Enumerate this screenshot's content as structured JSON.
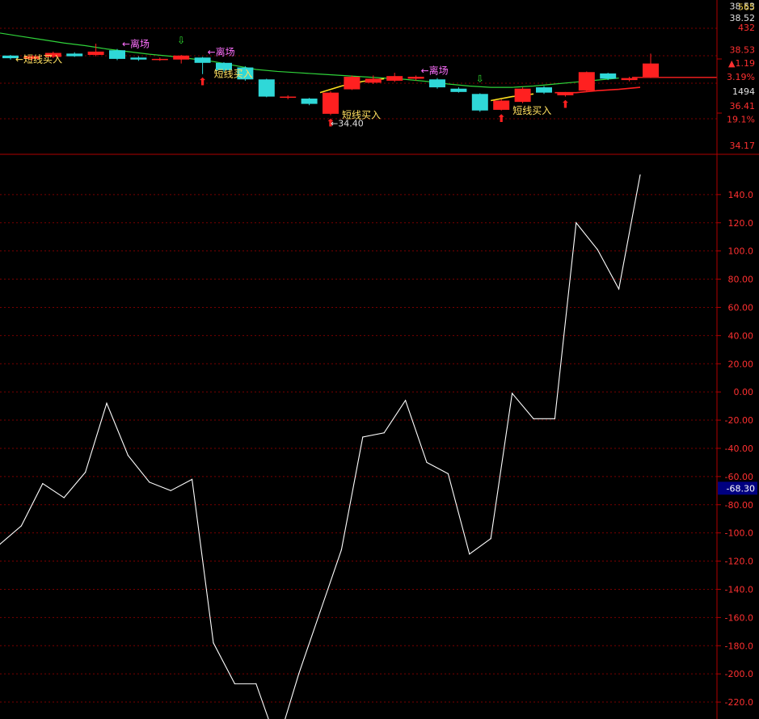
{
  "colors": {
    "background": "#000000",
    "grid": "#7a0000",
    "axis": "#b00000",
    "up": "#ff2020",
    "down": "#2fd8d8",
    "ma_line": "#2fd33a",
    "red_line": "#ff2020",
    "yellow_line": "#ffe020",
    "cci_line": "#ffffff",
    "label_buy": "#ffe060",
    "label_exit": "#ff70ff",
    "arrow_up": "#ff2020",
    "arrow_down": "#30e030",
    "tick_label": "#ff3030",
    "tick_label_white": "#e0e0e0",
    "tick_label_yellow": "#e0c040",
    "current_value_bg": "#000080"
  },
  "price_axis": {
    "labels": [
      {
        "text": "38.53",
        "value": 38.53,
        "color": "white"
      },
      {
        "text": "565",
        "value": 38.515,
        "color": "yellow"
      },
      {
        "text": "38.52",
        "value": 38.35,
        "color": "white"
      },
      {
        "text": "432",
        "value": 38.205,
        "color": "red"
      },
      {
        "text": "38.53",
        "value": 37.87,
        "color": "red"
      },
      {
        "text": "▲1.19",
        "value": 37.67,
        "color": "red"
      },
      {
        "text": "3.19%",
        "value": 37.46,
        "color": "red"
      },
      {
        "text": "1494",
        "value": 37.24,
        "color": "white"
      },
      {
        "text": "36.41",
        "value": 37.02,
        "color": "red"
      },
      {
        "text": "19.1%",
        "value": 36.82,
        "color": "red"
      },
      {
        "text": "34.17",
        "value": 36.42,
        "color": "red"
      }
    ]
  },
  "cci_axis": {
    "labels": [
      "140.0",
      "120.0",
      "100.0",
      "80.00",
      "60.00",
      "40.00",
      "20.00",
      "0.00",
      "-20.00",
      "-40.00",
      "-60.00",
      "-80.00",
      "-100.0",
      "-120.0",
      "-140.0",
      "-160.0",
      "-180.0",
      "-200.0",
      "-220.0"
    ],
    "current_value_label": "-68.30",
    "current_value": -68.3
  },
  "chart_data": [
    {
      "type": "candlestick",
      "title": "",
      "ylim": [
        36.3,
        38.62
      ],
      "x_count": 30,
      "candles": [
        {
          "o": 37.78,
          "c": 37.74,
          "h": 37.79,
          "l": 37.72
        },
        {
          "o": 37.73,
          "c": 37.77,
          "h": 37.78,
          "l": 37.7
        },
        {
          "o": 37.76,
          "c": 37.82,
          "h": 37.84,
          "l": 37.74
        },
        {
          "o": 37.81,
          "c": 37.77,
          "h": 37.83,
          "l": 37.76
        },
        {
          "o": 37.79,
          "c": 37.84,
          "h": 37.96,
          "l": 37.77
        },
        {
          "o": 37.86,
          "c": 37.73,
          "h": 37.88,
          "l": 37.71
        },
        {
          "o": 37.75,
          "c": 37.72,
          "h": 37.77,
          "l": 37.7
        },
        {
          "o": 37.73,
          "c": 37.73,
          "h": 37.75,
          "l": 37.7
        },
        {
          "o": 37.72,
          "c": 37.78,
          "h": 37.79,
          "l": 37.66
        },
        {
          "o": 37.75,
          "c": 37.67,
          "h": 37.76,
          "l": 37.5
        },
        {
          "o": 37.67,
          "c": 37.56,
          "h": 37.68,
          "l": 37.53
        },
        {
          "o": 37.6,
          "c": 37.42,
          "h": 37.62,
          "l": 37.4
        },
        {
          "o": 37.42,
          "c": 37.16,
          "h": 37.43,
          "l": 37.15
        },
        {
          "o": 37.16,
          "c": 37.16,
          "h": 37.18,
          "l": 37.12
        },
        {
          "o": 37.13,
          "c": 37.05,
          "h": 37.14,
          "l": 37.03
        },
        {
          "o": 36.9,
          "c": 37.22,
          "h": 37.24,
          "l": 36.88
        },
        {
          "o": 37.27,
          "c": 37.46,
          "h": 37.48,
          "l": 37.26
        },
        {
          "o": 37.37,
          "c": 37.43,
          "h": 37.48,
          "l": 37.35
        },
        {
          "o": 37.4,
          "c": 37.47,
          "h": 37.52,
          "l": 37.38
        },
        {
          "o": 37.43,
          "c": 37.46,
          "h": 37.48,
          "l": 37.4
        },
        {
          "o": 37.42,
          "c": 37.3,
          "h": 37.44,
          "l": 37.28
        },
        {
          "o": 37.28,
          "c": 37.23,
          "h": 37.3,
          "l": 37.22
        },
        {
          "o": 37.2,
          "c": 36.95,
          "h": 37.21,
          "l": 36.93
        },
        {
          "o": 36.96,
          "c": 37.1,
          "h": 37.12,
          "l": 36.95
        },
        {
          "o": 37.08,
          "c": 37.28,
          "h": 37.3,
          "l": 37.06
        },
        {
          "o": 37.3,
          "c": 37.22,
          "h": 37.32,
          "l": 37.2
        },
        {
          "o": 37.18,
          "c": 37.22,
          "h": 37.23,
          "l": 37.16
        },
        {
          "o": 37.25,
          "c": 37.53,
          "h": 37.54,
          "l": 37.24
        },
        {
          "o": 37.51,
          "c": 37.43,
          "h": 37.52,
          "l": 37.41
        },
        {
          "o": 37.41,
          "c": 37.44,
          "h": 37.46,
          "l": 37.39
        },
        {
          "o": 37.46,
          "c": 37.66,
          "h": 37.81,
          "l": 37.44
        }
      ],
      "ma_line": [
        38.12,
        38.07,
        38.02,
        37.97,
        37.93,
        37.88,
        37.84,
        37.8,
        37.77,
        37.73,
        37.69,
        37.63,
        37.57,
        37.54,
        37.52,
        37.5,
        37.48,
        37.46,
        37.44,
        37.42,
        37.39,
        37.35,
        37.32,
        37.3,
        37.3,
        37.32,
        37.35,
        37.38,
        37.41,
        37.44
      ],
      "red_line": [
        {
          "x": 26,
          "y": 37.22
        },
        {
          "x": 27,
          "y": 37.22
        },
        {
          "x": 28,
          "y": 37.25
        },
        {
          "x": 29,
          "y": 37.27
        },
        {
          "x": 30,
          "y": 37.3
        }
      ],
      "red_flat_line": {
        "y": 37.45,
        "x_start": 30
      },
      "yellow_lines": [
        [
          {
            "x": 15,
            "y": 37.22
          },
          {
            "x": 16,
            "y": 37.32
          },
          {
            "x": 17,
            "y": 37.39
          },
          {
            "x": 18,
            "y": 37.43
          }
        ],
        [
          {
            "x": 23,
            "y": 37.1
          },
          {
            "x": 24,
            "y": 37.16
          },
          {
            "x": 25,
            "y": 37.2
          }
        ]
      ],
      "signals": [
        {
          "type": "buy",
          "index": 0,
          "label": "←短线买入",
          "dir": "up"
        },
        {
          "type": "exit",
          "index": 5,
          "label": "←离场",
          "dir": "up"
        },
        {
          "type": "down",
          "index": 8,
          "label": "",
          "dir": "down"
        },
        {
          "type": "buy",
          "index": 9,
          "label": "短线买入",
          "dir": "up"
        },
        {
          "type": "exit",
          "index": 9,
          "label": "←离场",
          "dir": "up"
        },
        {
          "type": "buy",
          "index": 15,
          "label": "短线买入",
          "dir": "up"
        },
        {
          "type": "exit",
          "index": 19,
          "label": "←离场",
          "dir": "up"
        },
        {
          "type": "down",
          "index": 22,
          "label": "",
          "dir": "down"
        },
        {
          "type": "buy",
          "index": 23,
          "label": "短线买入",
          "dir": "up"
        },
        {
          "type": "arrow",
          "index": 26,
          "label": "",
          "dir": "up"
        }
      ],
      "annotations": [
        {
          "text": "←34.40",
          "index": 15
        }
      ]
    },
    {
      "type": "line",
      "title": "",
      "ylim": [
        -232,
        168
      ],
      "x_count": 30,
      "series": [
        {
          "values": [
            -108,
            -95,
            -65,
            -75,
            -57,
            -8,
            -45,
            -64,
            -70,
            -62,
            -178,
            -207,
            -207,
            -250,
            -200,
            -156,
            -112,
            -32,
            -29,
            -6,
            -50,
            -58,
            -115,
            -104,
            -1,
            -19,
            -19,
            120,
            101,
            73,
            154
          ]
        }
      ]
    }
  ]
}
